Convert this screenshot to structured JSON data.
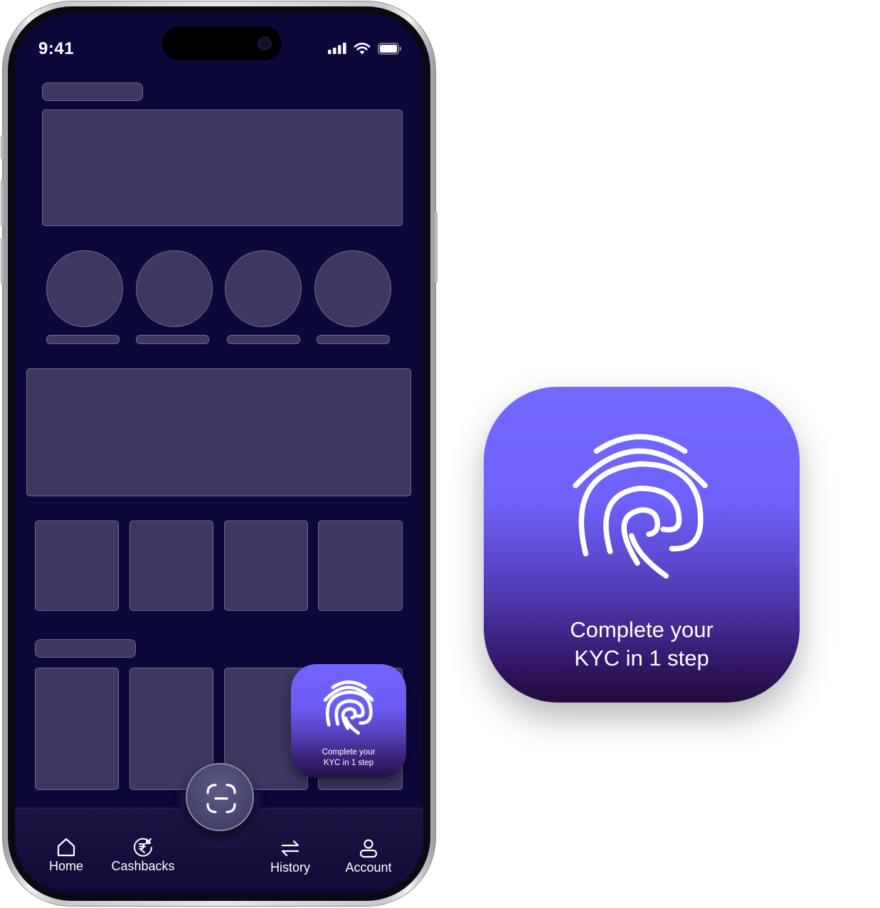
{
  "status_bar": {
    "time": "9:41"
  },
  "kyc_card": {
    "line1": "Complete your",
    "line2": "KYC in 1 step",
    "icon": "fingerprint-icon"
  },
  "nav": {
    "home": {
      "label": "Home",
      "icon": "home-icon"
    },
    "cashbacks": {
      "label": "Cashbacks",
      "icon": "rupee-cashback-icon"
    },
    "scan": {
      "icon": "scan-icon"
    },
    "history": {
      "label": "History",
      "icon": "transfer-arrows-icon"
    },
    "account": {
      "label": "Account",
      "icon": "user-icon"
    }
  },
  "colors": {
    "screen_bg": "#0d083a",
    "skeleton_fill": "#3d3860",
    "skeleton_border": "#6d6a8c",
    "card_top": "#7368ff",
    "card_bottom": "#220b3f"
  }
}
